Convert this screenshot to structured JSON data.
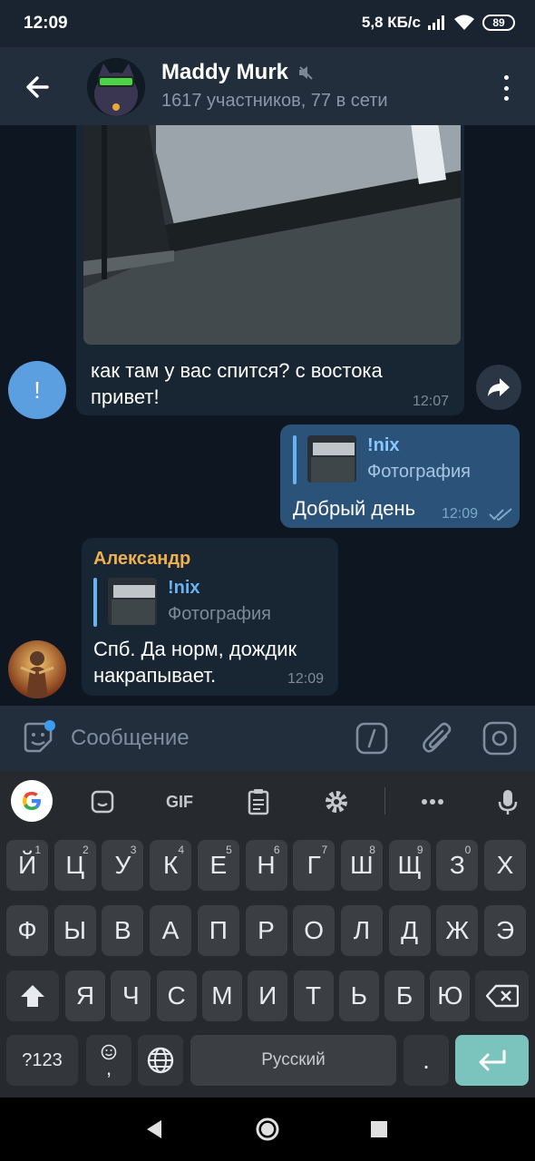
{
  "status_bar": {
    "time": "12:09",
    "network_speed": "5,8 КБ/с",
    "battery": "89",
    "icons": [
      "signal-icon",
      "wifi-icon",
      "battery-icon"
    ]
  },
  "header": {
    "title": "Maddy Murk",
    "subtitle": "1617 участников, 77 в сети",
    "icons": [
      "back-arrow-icon",
      "muted-speaker-icon",
      "more-vertical-icon"
    ]
  },
  "messages": [
    {
      "id": "m1",
      "sender_initial": "!",
      "has_photo": true,
      "text": "как там у вас спится? с востока привет!",
      "time": "12:07"
    },
    {
      "id": "m2",
      "outgoing": true,
      "reply": {
        "name": "!nix",
        "subtitle": "Фотография"
      },
      "text": "Добрый день",
      "time": "12:09",
      "status": "read"
    },
    {
      "id": "m3",
      "sender": "Александр",
      "reply": {
        "name": "!nix",
        "subtitle": "Фотография"
      },
      "text": "Спб. Да норм, дождик накрапывает.",
      "time": "12:09"
    }
  ],
  "input": {
    "placeholder": "Сообщение",
    "icons": [
      "sticker-icon",
      "command-slash-icon",
      "attach-paperclip-icon",
      "camera-icon"
    ]
  },
  "keyboard": {
    "toolbar": [
      "google-icon",
      "sticker-icon",
      "gif-icon",
      "clipboard-icon",
      "settings-icon",
      "more-icon",
      "microphone-icon"
    ],
    "gif_label": "GIF",
    "row1": [
      {
        "k": "Й",
        "h": "1"
      },
      {
        "k": "Ц",
        "h": "2"
      },
      {
        "k": "У",
        "h": "3"
      },
      {
        "k": "К",
        "h": "4"
      },
      {
        "k": "Е",
        "h": "5"
      },
      {
        "k": "Н",
        "h": "6"
      },
      {
        "k": "Г",
        "h": "7"
      },
      {
        "k": "Ш",
        "h": "8"
      },
      {
        "k": "Щ",
        "h": "9"
      },
      {
        "k": "З",
        "h": "0"
      },
      {
        "k": "Х",
        "h": ""
      }
    ],
    "row2": [
      "Ф",
      "Ы",
      "В",
      "А",
      "П",
      "Р",
      "О",
      "Л",
      "Д",
      "Ж",
      "Э"
    ],
    "row3": [
      "Я",
      "Ч",
      "С",
      "М",
      "И",
      "Т",
      "Ь",
      "Б",
      "Ю"
    ],
    "symbols_label": "?123",
    "emoji_comma": ",",
    "space_label": "Русский",
    "period_label": "."
  },
  "colors": {
    "accent_blue": "#6ab3f3",
    "sender_name_orange": "#f0b04e",
    "outgoing_bubble": "#2b5278",
    "incoming_bubble": "#182533",
    "enter_key": "#7bc4bd"
  }
}
